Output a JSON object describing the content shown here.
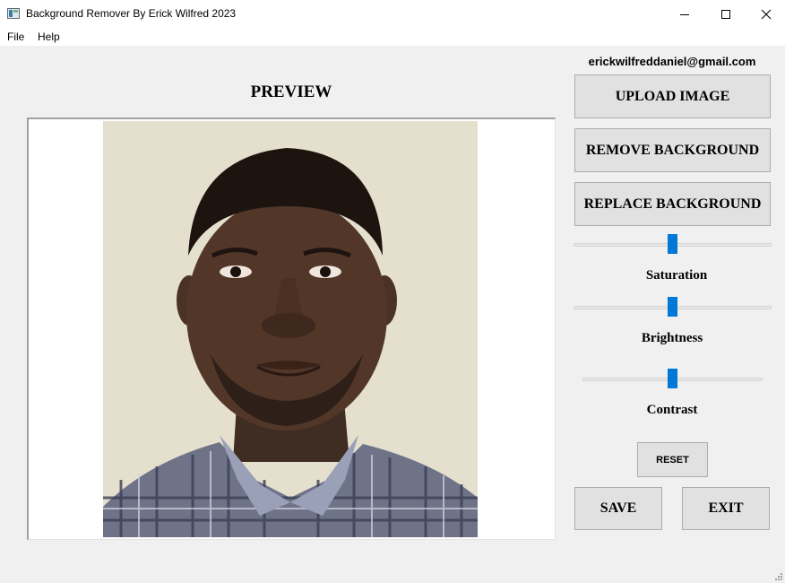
{
  "window": {
    "title": "Background Remover By Erick Wilfred 2023",
    "icon": "app-window-icon",
    "controls": [
      "minimize-icon",
      "maximize-icon",
      "close-icon"
    ]
  },
  "menu": {
    "items": [
      {
        "label": "File"
      },
      {
        "label": "Help"
      }
    ]
  },
  "preview": {
    "title": "PREVIEW"
  },
  "sidebar": {
    "email": "erickwilfreddaniel@gmail.com",
    "upload_label": "UPLOAD IMAGE",
    "remove_label": "REMOVE BACKGROUND",
    "replace_label": "REPLACE BACKGROUND",
    "sliders": [
      {
        "label": "Saturation",
        "value_fraction": 0.5
      },
      {
        "label": "Brightness",
        "value_fraction": 0.5
      },
      {
        "label": "Contrast",
        "value_fraction": 0.5
      }
    ],
    "reset_label": "RESET",
    "save_label": "SAVE",
    "exit_label": "EXIT"
  },
  "colors": {
    "slider_thumb": "#0078d7",
    "window_bg": "#f0f0f0",
    "button_bg": "#e1e1e1"
  }
}
